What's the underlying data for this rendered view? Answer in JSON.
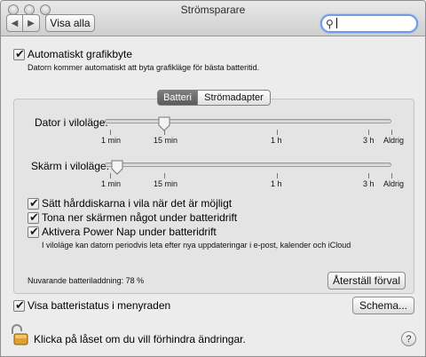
{
  "window": {
    "title": "Strömsparare",
    "show_all_label": "Visa alla",
    "search_value": ""
  },
  "icons": {
    "back": "chevron-left-icon",
    "forward": "chevron-right-icon",
    "search": "search-icon",
    "lock": "lock-open-icon",
    "help": "question-icon"
  },
  "graphics": {
    "auto_switch_label": "Automatiskt grafikbyte",
    "auto_switch_checked": true,
    "auto_switch_desc": "Datorn kommer automatiskt att byta grafikläge för bästa batteritid."
  },
  "tabs": [
    {
      "label": "Batteri",
      "selected": true
    },
    {
      "label": "Strömadapter",
      "selected": false
    }
  ],
  "sleep": {
    "computer_label": "Dator i viloläge:",
    "display_label": "Skärm i viloläge:",
    "scale": [
      "1 min",
      "15 min",
      "1 h",
      "3 h",
      "Aldrig"
    ],
    "computer_value": "15 min",
    "display_value": "2 min"
  },
  "options": [
    {
      "label": "Sätt hårddiskarna i vila när det är möjligt",
      "checked": true
    },
    {
      "label": "Tona ner skärmen något under batteridrift",
      "checked": true
    },
    {
      "label": "Aktivera Power Nap under batteridrift",
      "checked": true
    }
  ],
  "power_nap_desc": "I viloläge kan datorn periodvis leta efter nya uppdateringar i e-post, kalender och iCloud",
  "battery_charge": "Nuvarande batteriladdning: 78 %",
  "restore_label": "Återställ förval",
  "show_status": {
    "label": "Visa batteristatus i menyraden",
    "checked": true
  },
  "schedule_label": "Schema...",
  "lock_text": "Klicka på låset om du vill förhindra ändringar.",
  "help_label": "?"
}
